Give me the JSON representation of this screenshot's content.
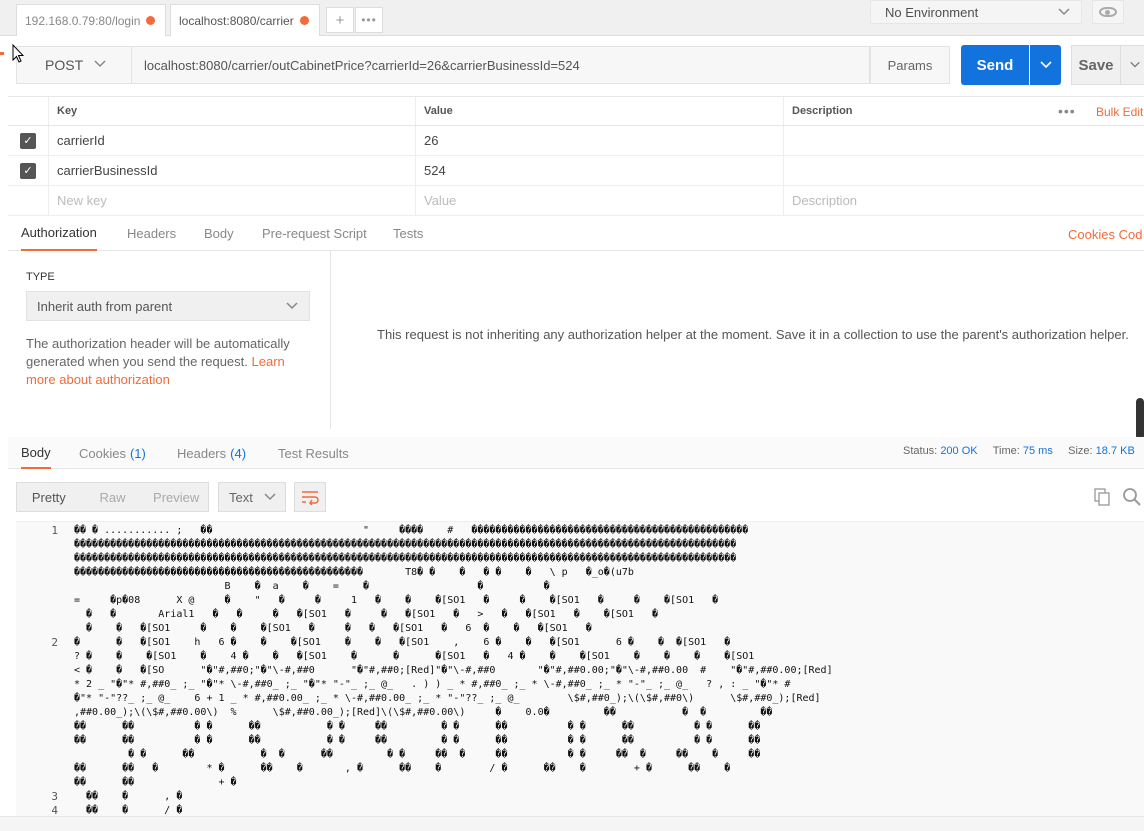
{
  "tabs": [
    {
      "label": "192.168.0.79:80/login"
    },
    {
      "label": "localhost:8080/carrier"
    }
  ],
  "environment": {
    "selected": "No Environment"
  },
  "request": {
    "method": "POST",
    "url": "localhost:8080/carrier/outCabinetPrice?carrierId=26&carrierBusinessId=524",
    "params_label": "Params",
    "send_label": "Send",
    "save_label": "Save"
  },
  "params_table": {
    "headers": {
      "key": "Key",
      "value": "Value",
      "description": "Description",
      "bulk_edit": "Bulk Edit"
    },
    "rows": [
      {
        "key": "carrierId",
        "value": "26",
        "description": ""
      },
      {
        "key": "carrierBusinessId",
        "value": "524",
        "description": ""
      }
    ],
    "new_row": {
      "key_placeholder": "New key",
      "value_placeholder": "Value",
      "description_placeholder": "Description"
    }
  },
  "request_tabs": {
    "items": [
      "Authorization",
      "Headers",
      "Body",
      "Pre-request Script",
      "Tests"
    ],
    "right_links": "Cookies  Cod"
  },
  "auth": {
    "type_label": "TYPE",
    "type_value": "Inherit auth from parent",
    "desc_text": "The authorization header will be automatically generated when you send the request. ",
    "desc_link": "Learn more about authorization",
    "message": "This request is not inheriting any authorization helper at the moment. Save it in a collection to use the parent's authorization helper."
  },
  "response": {
    "tabs": {
      "body": "Body",
      "cookies": "Cookies",
      "cookies_count": "(1)",
      "headers": "Headers",
      "headers_count": "(4)",
      "test_results": "Test Results"
    },
    "status_label": "Status:",
    "status_value": "200 OK",
    "time_label": "Time:",
    "time_value": "75 ms",
    "size_label": "Size:",
    "size_value": "18.7 KB",
    "view_modes": [
      "Pretty",
      "Raw",
      "Preview"
    ],
    "format": "Text",
    "line_numbers": [
      "1",
      "2",
      "3",
      "4"
    ],
    "body_lines": [
      "�� � ........... ;   ��                         \"     ����    #   ����������������������������������������������",
      "��������������������������������������������������������������������������������������������������������������",
      "��������������������������������������������������������������������������������������������������������������",
      "������������������������������������������������       T8� �    �   � �    �   \\ p   �_o�(u7b",
      "                         B    �  a    �    =    �                  �          �",
      "=     �p�08      X @     �    \"   �     �     1   �    �    �[SO1   �     �    �[SO1   �     �    �[SO1   �",
      "  �   �       Arial1   �   �     �   �[SO1   �     �   �[SO1   �   >   �   �[SO1   �    �[SO1   �",
      "  �    �   �[SO1     �    �    �[SO1   �     �   �   �[SO1   �   6  �    �   �[SO1   �",
      "�      �   �[SO1    h   6 �    �    �[SO1    �    �   �[SO1    ,    6 �    �   �[SO1      6 �    �  �[SO1   �",
      "? �    �    �[SO1    �    4 �    �   �[SO1    �      �      �[SO1   �   4 �    �    �[SO1    �    �    �    �[SO1",
      "< �    �   �[SO      \"�\"#,##0;\"�\"\\-#,##0      \"�\"#,##0;[Red]\"�\"\\-#,##0       \"�\"#,##0.00;\"�\"\\-#,##0.00  #    \"�\"#,##0.00;[Red]",
      "* 2 _ \"�\"* #,##0_ ;_ \"�\"* \\-#,##0_ ;_ \"�\"* \"-\"_ ;_ @_   . ) ) _ * #,##0_ ;_ * \\-#,##0_ ;_ * \"-\"_ ;_ @_   ? , : _ \"�\"* #",
      "�\"* \"-\"??_ ;_ @_    6 + 1 _ * #,##0.00_ ;_ * \\-#,##0.00_ ;_ * \"-\"??_ ;_ @_        \\$#,##0_);\\(\\$#,##0\\)      \\$#,##0_);[Red]",
      ",##0.00_);\\(\\$#,##0.00\\)  %      \\$#,##0.00_);[Red]\\(\\$#,##0.00\\)     �    0.0�         ��           �  �         ��",
      "��      ��          � �      ��           � �     ��         � �      ��          � �      ��          � �      ��",
      "��      ��          � �      ��           � �     ��         � �      ��          � �      ��          � �      ��",
      "         � �      ��           �  �      ��         � �     ��  �     ��          � �     ��  �     ��    �     ��",
      "��      ��   �        * �      ��    �       , �      ��    �        / �      ��    �        + �      ��    �",
      "��      ��              + �",
      "  ��    �      , �",
      "  ��    �      / �"
    ]
  }
}
